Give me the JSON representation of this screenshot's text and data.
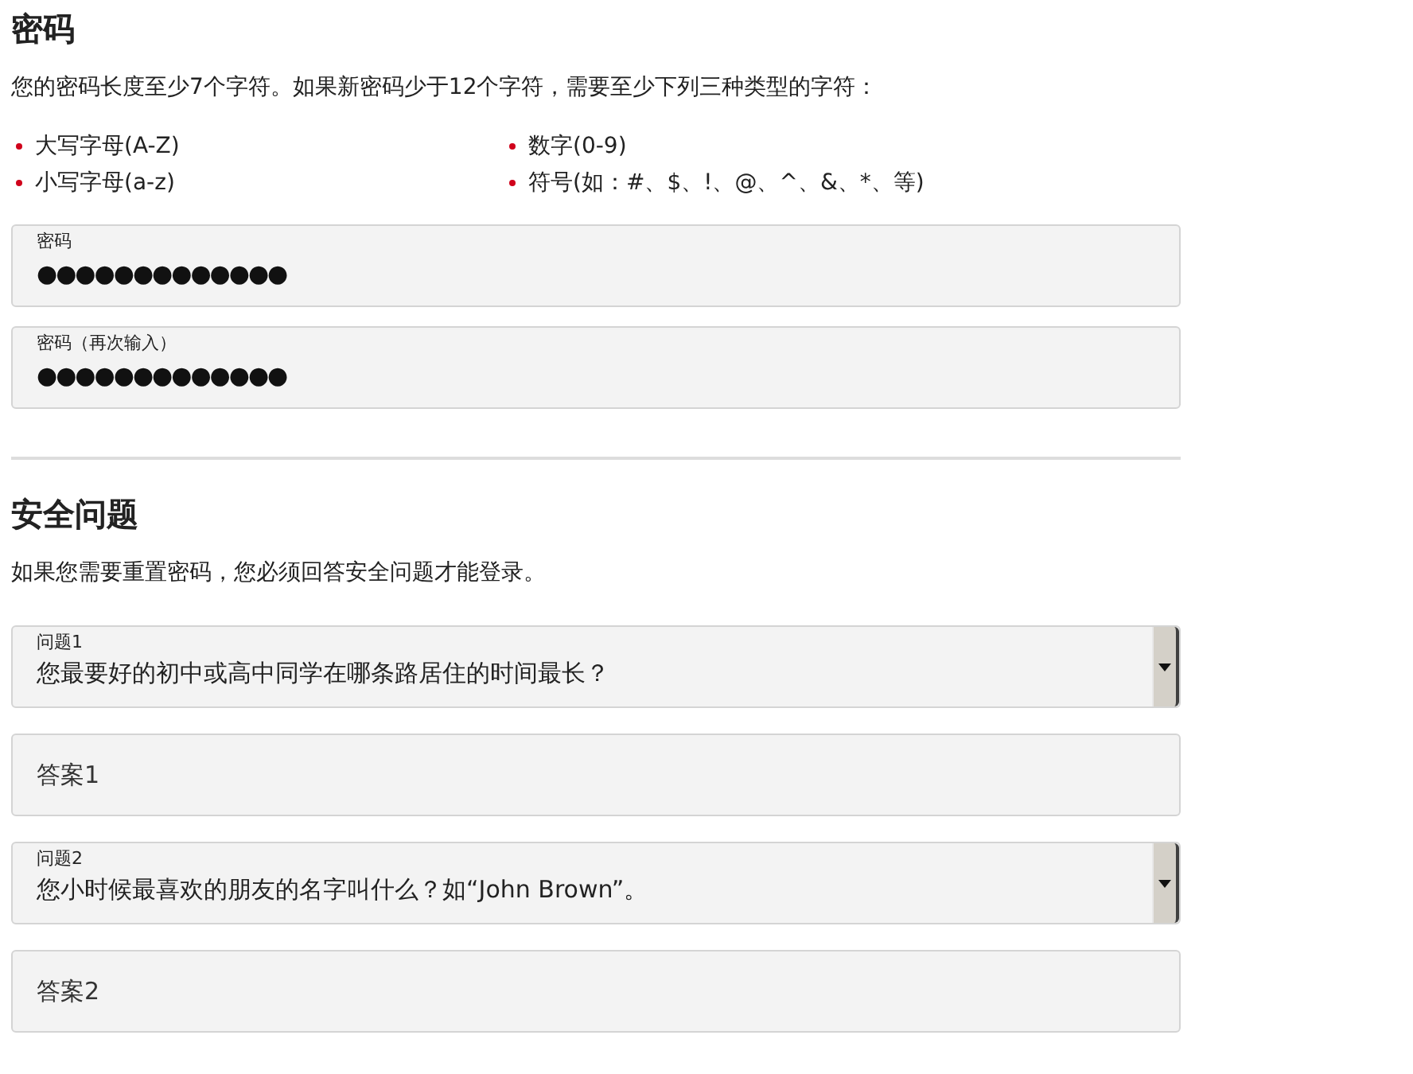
{
  "password_section": {
    "heading": "密码",
    "rules_intro": "您的密码长度至少7个字符。如果新密码少于12个字符，需要至少下列三种类型的字符：",
    "rules": [
      [
        "大写字母(A-Z)",
        "小写字母(a-z)"
      ],
      [
        "数字(0-9)",
        "符号(如：#、$、!、@、^、&、*、等)"
      ]
    ],
    "fields": [
      {
        "label": "密码",
        "value": "●●●●●●●●●●●●●"
      },
      {
        "label": "密码（再次输入）",
        "value": "●●●●●●●●●●●●●"
      }
    ]
  },
  "security_section": {
    "heading": "安全问题",
    "intro": "如果您需要重置密码，您必须回答安全问题才能登录。",
    "fields": [
      {
        "kind": "select",
        "label": "问题1",
        "value": "您最要好的初中或高中同学在哪条路居住的时间最长？"
      },
      {
        "kind": "text",
        "placeholder": "答案1"
      },
      {
        "kind": "select",
        "label": "问题2",
        "value": "您小时候最喜欢的朋友的名字叫什么？如“John Brown”。"
      },
      {
        "kind": "text",
        "placeholder": "答案2"
      }
    ]
  }
}
